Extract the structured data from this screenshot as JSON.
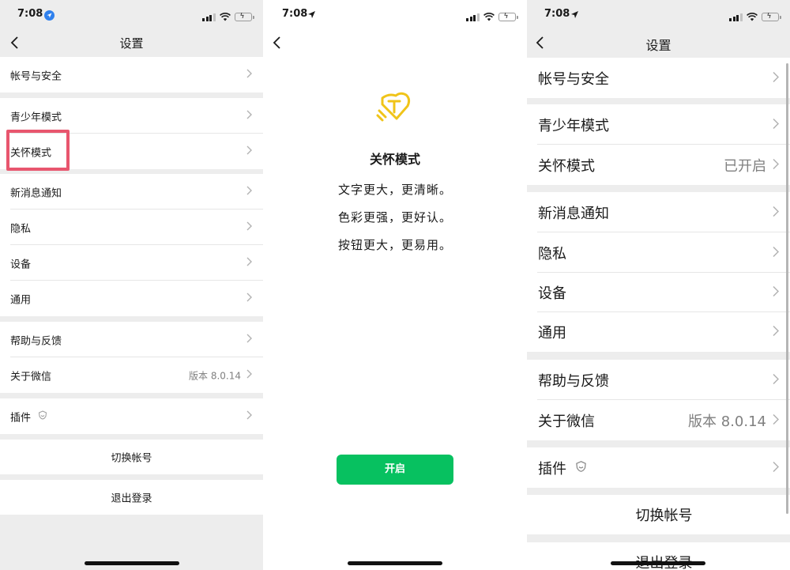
{
  "colors": {
    "accent_green": "#07c160",
    "highlight_red": "#e8566e",
    "group_gap": "#ededed",
    "value_gray": "#808080"
  },
  "status": {
    "time": "7:08"
  },
  "screen1": {
    "title": "设置",
    "rows": {
      "account_security": "帐号与安全",
      "youth_mode": "青少年模式",
      "care_mode": "关怀模式",
      "notifications": "新消息通知",
      "privacy": "隐私",
      "devices": "设备",
      "general": "通用",
      "help_feedback": "帮助与反馈",
      "about": "关于微信",
      "about_version": "版本 8.0.14",
      "plugins": "插件",
      "switch_account": "切换帐号",
      "logout": "退出登录"
    }
  },
  "screen2": {
    "title": "关怀模式",
    "lines": [
      "文字更大，更清晰。",
      "色彩更强，更好认。",
      "按钮更大，更易用。"
    ],
    "enable_label": "开启"
  },
  "screen3": {
    "title": "设置",
    "rows": {
      "account_security": "帐号与安全",
      "youth_mode": "青少年模式",
      "care_mode": "关怀模式",
      "care_mode_status": "已开启",
      "notifications": "新消息通知",
      "privacy": "隐私",
      "devices": "设备",
      "general": "通用",
      "help_feedback": "帮助与反馈",
      "about": "关于微信",
      "about_version": "版本 8.0.14",
      "plugins": "插件",
      "switch_account": "切换帐号",
      "logout": "退出登录"
    }
  },
  "icons": {
    "back": "chevron-left-icon",
    "chevron": "chevron-right-icon",
    "plugin": "shield-face-icon",
    "care": "heart-hand-icon",
    "location": "location-arrow-icon",
    "signal": "cellular-signal-icon",
    "wifi": "wifi-icon",
    "battery": "battery-charging-icon"
  }
}
